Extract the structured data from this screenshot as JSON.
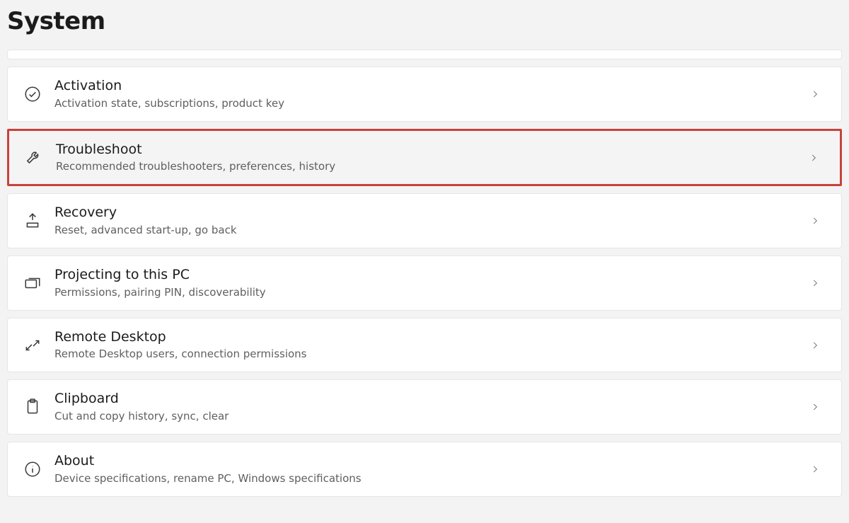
{
  "page_title": "System",
  "items": [
    {
      "id": "activation",
      "title": "Activation",
      "desc": "Activation state, subscriptions, product key",
      "highlighted": false
    },
    {
      "id": "troubleshoot",
      "title": "Troubleshoot",
      "desc": "Recommended troubleshooters, preferences, history",
      "highlighted": true
    },
    {
      "id": "recovery",
      "title": "Recovery",
      "desc": "Reset, advanced start-up, go back",
      "highlighted": false
    },
    {
      "id": "projecting",
      "title": "Projecting to this PC",
      "desc": "Permissions, pairing PIN, discoverability",
      "highlighted": false
    },
    {
      "id": "remote",
      "title": "Remote Desktop",
      "desc": "Remote Desktop users, connection permissions",
      "highlighted": false
    },
    {
      "id": "clipboard",
      "title": "Clipboard",
      "desc": "Cut and copy history, sync, clear",
      "highlighted": false
    },
    {
      "id": "about",
      "title": "About",
      "desc": "Device specifications, rename PC, Windows specifications",
      "highlighted": false
    }
  ]
}
